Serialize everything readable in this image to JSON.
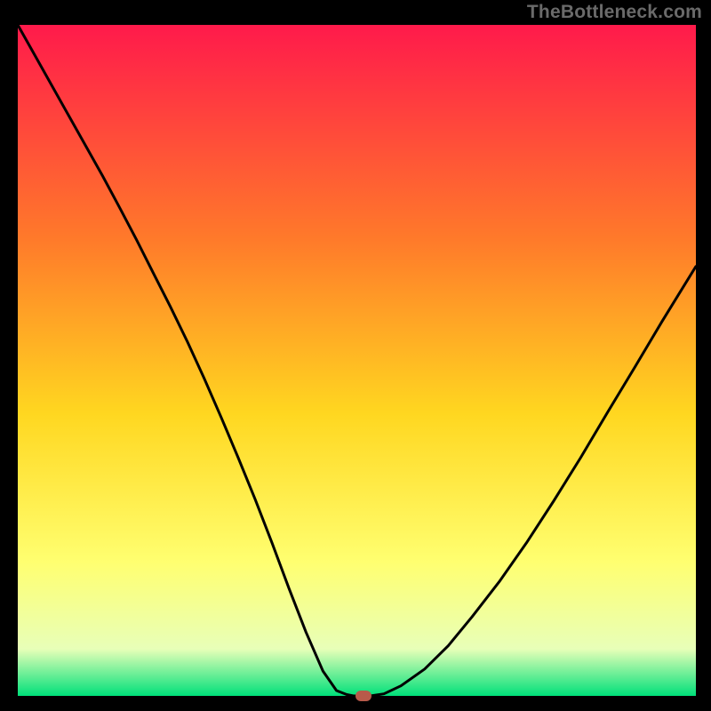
{
  "watermark": "TheBottleneck.com",
  "colors": {
    "gradient_top": "#ff1a4b",
    "gradient_mid1": "#ff7a2a",
    "gradient_mid2": "#ffd720",
    "gradient_mid3": "#ffff70",
    "gradient_mid4": "#e8ffb8",
    "gradient_bottom": "#00e07a",
    "curve": "#000000",
    "marker": "#b85a4a",
    "frame_bg": "#000000"
  },
  "chart_data": {
    "type": "line",
    "title": "",
    "xlabel": "",
    "ylabel": "",
    "xlim": [
      0,
      100
    ],
    "ylim": [
      0,
      100
    ],
    "grid": false,
    "legend": false,
    "series": [
      {
        "name": "bottleneck-curve",
        "x": [
          0.0,
          2.5,
          5.0,
          7.5,
          10.0,
          12.5,
          15.0,
          17.5,
          20.0,
          22.5,
          25.0,
          27.5,
          30.0,
          32.5,
          35.0,
          37.5,
          40.0,
          42.5,
          45.0,
          47.0,
          48.5,
          49.5,
          50.5,
          52.0,
          54.0,
          56.5,
          60.0,
          63.5,
          67.0,
          71.0,
          75.0,
          79.0,
          83.0,
          87.0,
          91.0,
          95.0,
          100.0
        ],
        "y": [
          100.0,
          95.5,
          91.0,
          86.5,
          82.0,
          77.5,
          72.8,
          68.0,
          63.0,
          58.0,
          52.8,
          47.3,
          41.5,
          35.5,
          29.3,
          22.8,
          16.0,
          9.5,
          3.7,
          0.8,
          0.2,
          0.0,
          0.0,
          0.0,
          0.3,
          1.5,
          4.0,
          7.5,
          11.8,
          17.0,
          22.8,
          29.0,
          35.5,
          42.3,
          49.0,
          55.8,
          64.0
        ]
      }
    ],
    "annotations": [
      {
        "name": "minimum-marker",
        "shape": "pill",
        "x": 51.0,
        "y": 0.0
      }
    ]
  }
}
